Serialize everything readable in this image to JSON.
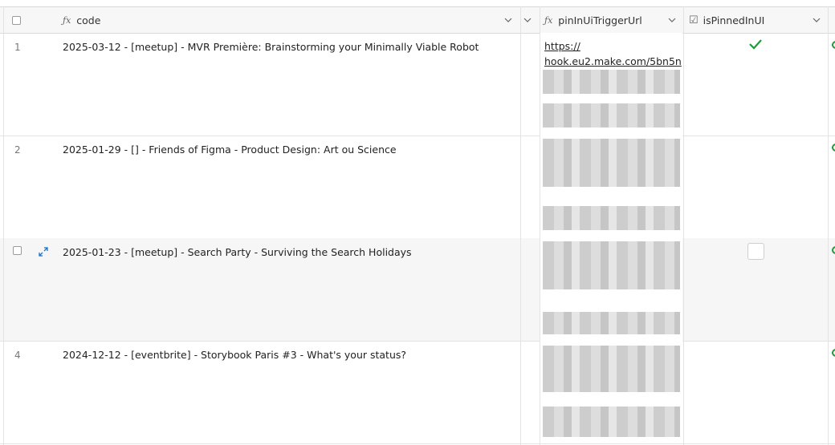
{
  "header": {
    "code_label": "code",
    "url_label": "pinInUiTriggerUrl",
    "pinned_label": "isPinnedInUI",
    "fx_symbol": "ƒx",
    "checkbox_symbol": "☑"
  },
  "rows": [
    {
      "num": "1",
      "code": "2025-03-12 - [meetup] - MVR Première: Brainstorming your Minimally Viable Robot",
      "url_line1": "https://",
      "url_line2": "hook.eu2.make.com/5bn5n",
      "pinned": "checked"
    },
    {
      "num": "2",
      "code": "2025-01-29 - [] - Friends of Figma - Product Design: Art ou Science",
      "pinned": "empty"
    },
    {
      "num": "",
      "code": "2025-01-23 - [meetup] - Search Party - Surviving the Search Holidays",
      "pinned": "unchecked"
    },
    {
      "num": "4",
      "code": "2024-12-12 - [eventbrite] - Storybook Paris #3 - What's your status?",
      "pinned": "empty"
    }
  ],
  "colors": {
    "check": "#1e9a3c",
    "status_dot": "#1e9a3c",
    "expand_icon": "#1a73c9"
  }
}
